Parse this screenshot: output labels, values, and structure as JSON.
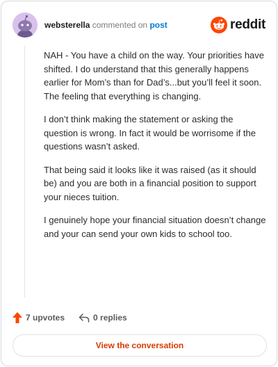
{
  "header": {
    "username": "websterella",
    "commented_text": "commented on",
    "post_link": "post",
    "brand": "reddit"
  },
  "comment": {
    "paragraphs": [
      "NAH - You have a child on the way. Your priorities have shifted. I do understand that this generally happens earlier for Mom’s than for Dad’s...but you’ll feel it soon. The feeling that everything is changing.",
      "I don’t think making the statement or asking the question is wrong. In fact it would be worrisome if the questions wasn’t asked.",
      "That being said it looks like it was raised (as it should be) and you are both in a financial position to support your nieces tuition.",
      "I genuinely hope your financial situation doesn’t change and your can send your own kids to school too."
    ]
  },
  "actions": {
    "upvotes_label": "7 upvotes",
    "replies_label": "0 replies"
  },
  "footer": {
    "view_conversation_label": "View the conversation"
  },
  "colors": {
    "brand_orange": "#ff4500",
    "link_blue": "#0079d3",
    "cta_text": "#d93a00"
  },
  "icons": {
    "avatar": "snoo-avatar",
    "logo": "reddit-snoo-icon",
    "upvote": "upvote-arrow-icon",
    "reply": "reply-arrow-icon"
  }
}
